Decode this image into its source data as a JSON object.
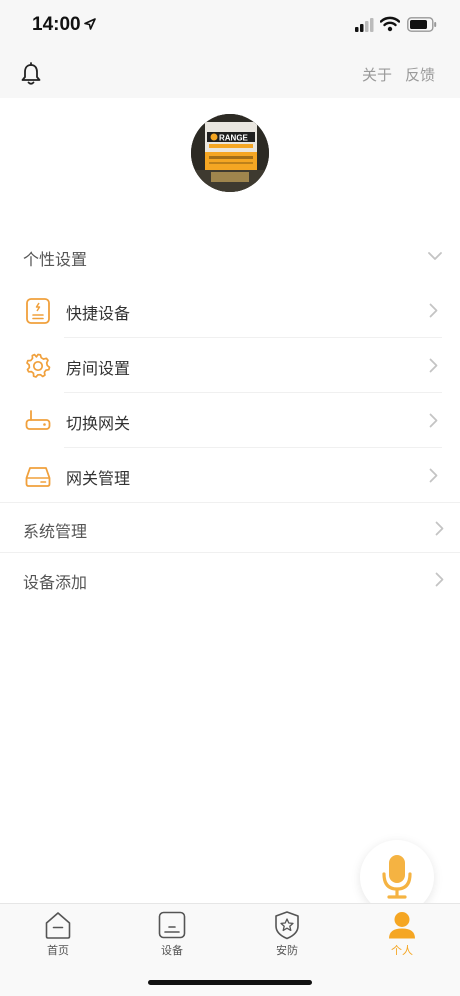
{
  "status_bar": {
    "time": "14:00"
  },
  "header": {
    "about_label": "关于",
    "feedback_label": "反馈"
  },
  "sections": {
    "personal": "个性设置",
    "system": "系统管理",
    "add_device": "设备添加"
  },
  "menu_items": [
    {
      "label": "快捷设备",
      "icon": "quick-device-icon"
    },
    {
      "label": "房间设置",
      "icon": "gear-icon"
    },
    {
      "label": "切换网关",
      "icon": "router-icon"
    },
    {
      "label": "网关管理",
      "icon": "gateway-icon"
    }
  ],
  "avatar": {
    "brand_text": "RANGE"
  },
  "tabs": [
    {
      "label": "首页",
      "icon": "home-icon"
    },
    {
      "label": "设备",
      "icon": "device-icon"
    },
    {
      "label": "安防",
      "icon": "shield-icon"
    },
    {
      "label": "个人",
      "icon": "person-icon",
      "active": true
    }
  ],
  "colors": {
    "accent": "#f5a623",
    "icon_orange": "#f0a03c"
  }
}
